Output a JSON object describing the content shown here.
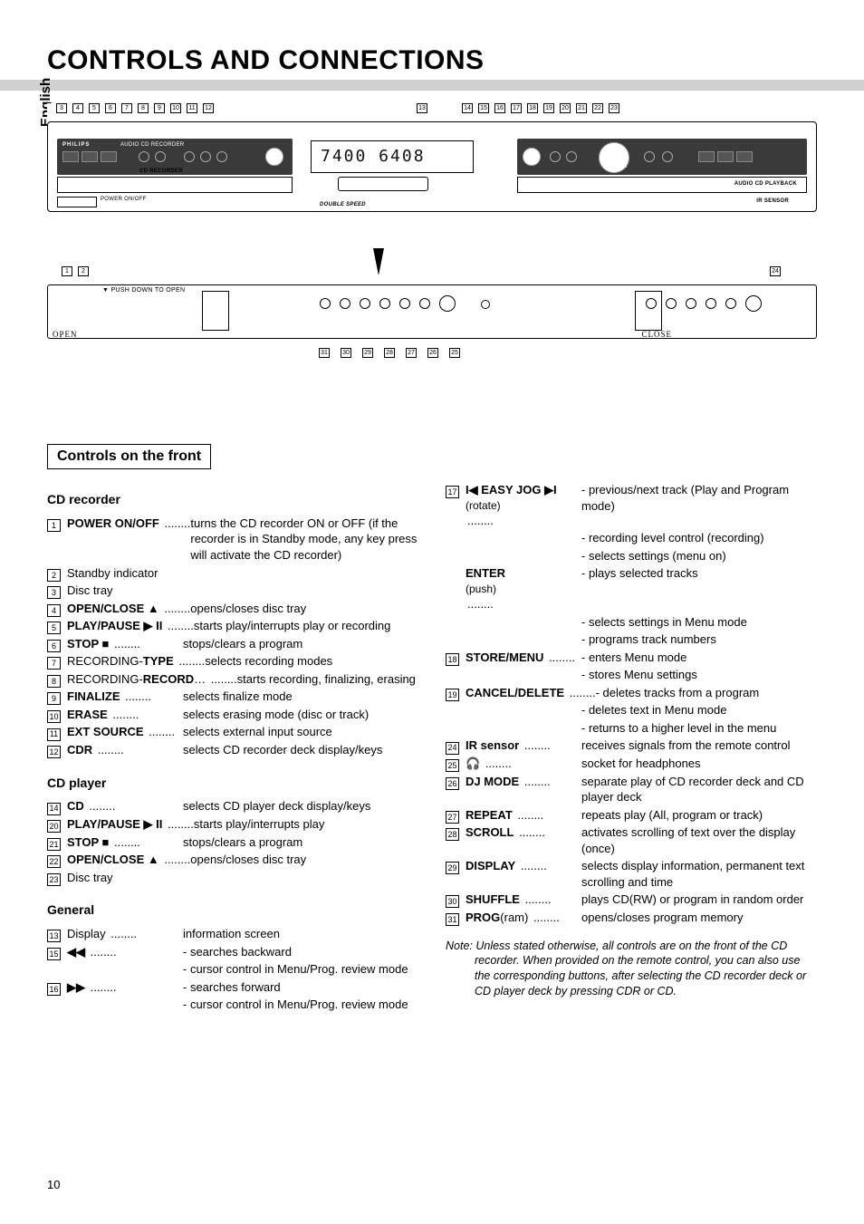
{
  "page_number": "10",
  "side_tab": "English",
  "title": "CONTROLS AND CONNECTIONS",
  "section_title": "Controls on the front",
  "diagram": {
    "top_numbers_left": [
      "3",
      "4",
      "5",
      "6",
      "7",
      "8",
      "9",
      "10",
      "11",
      "12"
    ],
    "top_numbers_mid": [
      "13"
    ],
    "top_numbers_right": [
      "14",
      "15",
      "16",
      "17",
      "18",
      "19",
      "20",
      "21",
      "22",
      "23"
    ],
    "bottom_top_left": [
      "1",
      "2"
    ],
    "bottom_top_right": [
      "24"
    ],
    "bottom_lower": [
      "31",
      "30",
      "29",
      "28",
      "27",
      "26",
      "25"
    ],
    "labels": {
      "brand": "PHILIPS",
      "rec_label": "AUDIO CD RECORDER",
      "cd_recorder": "CD RECORDER",
      "power": "POWER ON/OFF",
      "double_speed": "DOUBLE SPEED",
      "push_down": "▼ PUSH DOWN TO OPEN",
      "ir_sensor": "IR SENSOR",
      "audio_playback": "AUDIO CD PLAYBACK",
      "easy_jog": "EASY JOG",
      "enter": "ENTER",
      "open": "OPEN",
      "close": "CLOSE",
      "display_text": "7400 6408",
      "open_close": "OPEN/CLOSE",
      "play_pause": "PLAY/PAUSE",
      "stop": "STOP",
      "rec_type": "REC TYPE",
      "record": "RECORD",
      "finalize": "FINALIZE",
      "erase": "ERASE",
      "ext_source": "EXT SOURCE",
      "cdr": "CDR",
      "prog": "PROG",
      "shuffle": "SHUFFLE",
      "display": "DISPLAY",
      "scroll": "SCROLL",
      "repeat": "REPEAT",
      "dj_mode": "DJ MODE",
      "store_menu": "STORE MENU",
      "cancel_delete": "CANCEL/DELETE"
    }
  },
  "controls": {
    "cd_recorder_head": "CD recorder",
    "cd_player_head": "CD player",
    "general_head": "General",
    "items_recorder": [
      {
        "n": "1",
        "term": "POWER ON/OFF",
        "desc": "turns the CD recorder ON or OFF (if the recorder is in Standby mode, any key press will activate the CD recorder)"
      },
      {
        "n": "2",
        "term": "",
        "plain": "Standby indicator"
      },
      {
        "n": "3",
        "term": "",
        "plain": "Disc tray"
      },
      {
        "n": "4",
        "term": "OPEN/CLOSE ▲",
        "desc": "opens/closes disc tray"
      },
      {
        "n": "5",
        "term": "PLAY/PAUSE ▶ II",
        "desc": "starts play/interrupts play or recording"
      },
      {
        "n": "6",
        "term": "STOP ■",
        "desc": "stops/clears a program"
      },
      {
        "n": "7",
        "prefix": "RECORDING-",
        "term": "TYPE",
        "desc": "selects recording modes"
      },
      {
        "n": "8",
        "prefix": "RECORDING-",
        "term": "RECORD",
        "tail": "…",
        "desc": "starts recording, finalizing, erasing"
      },
      {
        "n": "9",
        "term": "FINALIZE",
        "desc": "selects finalize mode"
      },
      {
        "n": "10",
        "term": "ERASE",
        "desc": "selects erasing mode (disc or track)"
      },
      {
        "n": "11",
        "term": "EXT SOURCE",
        "desc": "selects external input source"
      },
      {
        "n": "12",
        "term": "CDR",
        "desc": "selects CD recorder deck display/keys"
      }
    ],
    "items_player": [
      {
        "n": "14",
        "term": "CD",
        "desc": "selects CD player deck display/keys"
      },
      {
        "n": "20",
        "term": "PLAY/PAUSE ▶ II",
        "desc": "starts play/interrupts play"
      },
      {
        "n": "21",
        "term": "STOP ■",
        "desc": "stops/clears a program"
      },
      {
        "n": "22",
        "term": "OPEN/CLOSE ▲",
        "desc": "opens/closes disc tray"
      },
      {
        "n": "23",
        "term": "",
        "plain": "Disc tray"
      }
    ],
    "items_general_left": [
      {
        "n": "13",
        "term": "",
        "plain": "Display",
        "desc": "information screen"
      },
      {
        "n": "15",
        "term": "◀◀",
        "desc": "- searches backward"
      },
      {
        "cont": true,
        "desc": "- cursor control in Menu/Prog. review mode"
      },
      {
        "n": "16",
        "term": "▶▶",
        "desc": "- searches forward"
      },
      {
        "cont": true,
        "desc": "- cursor control in Menu/Prog. review mode"
      }
    ],
    "items_general_right": [
      {
        "n": "17",
        "term": "I◀ EASY JOG ▶I",
        "sub": "(rotate)",
        "desc": "- previous/next track (Play and Program mode)"
      },
      {
        "cont": true,
        "desc": "- recording level control (recording)"
      },
      {
        "cont": true,
        "desc": "- selects settings (menu on)"
      },
      {
        "term": "ENTER",
        "sub": "(push)",
        "desc": "- plays selected tracks",
        "noNum": true
      },
      {
        "cont": true,
        "desc": "- selects settings in Menu mode"
      },
      {
        "cont": true,
        "desc": "- programs track numbers"
      },
      {
        "n": "18",
        "term": "STORE/MENU",
        "desc": "- enters Menu mode"
      },
      {
        "cont": true,
        "desc": "- stores Menu settings"
      },
      {
        "n": "19",
        "term": "CANCEL/DELETE",
        "desc": "- deletes tracks from a program"
      },
      {
        "cont": true,
        "desc": "- deletes text in Menu mode"
      },
      {
        "cont": true,
        "desc": "- returns to a higher level in the menu"
      },
      {
        "n": "24",
        "term": "IR sensor",
        "desc": "receives signals from the remote control"
      },
      {
        "n": "25",
        "term": "🎧",
        "desc": "socket for headphones"
      },
      {
        "n": "26",
        "term": "DJ MODE",
        "desc": "separate play of CD recorder deck and CD player deck"
      },
      {
        "n": "27",
        "term": "REPEAT",
        "desc": "repeats play (All, program or track)"
      },
      {
        "n": "28",
        "term": "SCROLL",
        "desc": "activates scrolling of text over the display (once)"
      },
      {
        "n": "29",
        "term": "DISPLAY",
        "desc": "selects display information, permanent text scrolling and time"
      },
      {
        "n": "30",
        "term": "SHUFFLE",
        "desc": "plays CD(RW) or program in random order"
      },
      {
        "n": "31",
        "term": "PROG",
        "tail": "(ram)",
        "desc": "opens/closes program memory"
      }
    ],
    "note": "Note: Unless stated otherwise, all controls are on the front of the CD recorder. When provided on the remote control, you can also use the corresponding buttons, after selecting the CD recorder deck or CD player deck by pressing CDR or CD."
  }
}
